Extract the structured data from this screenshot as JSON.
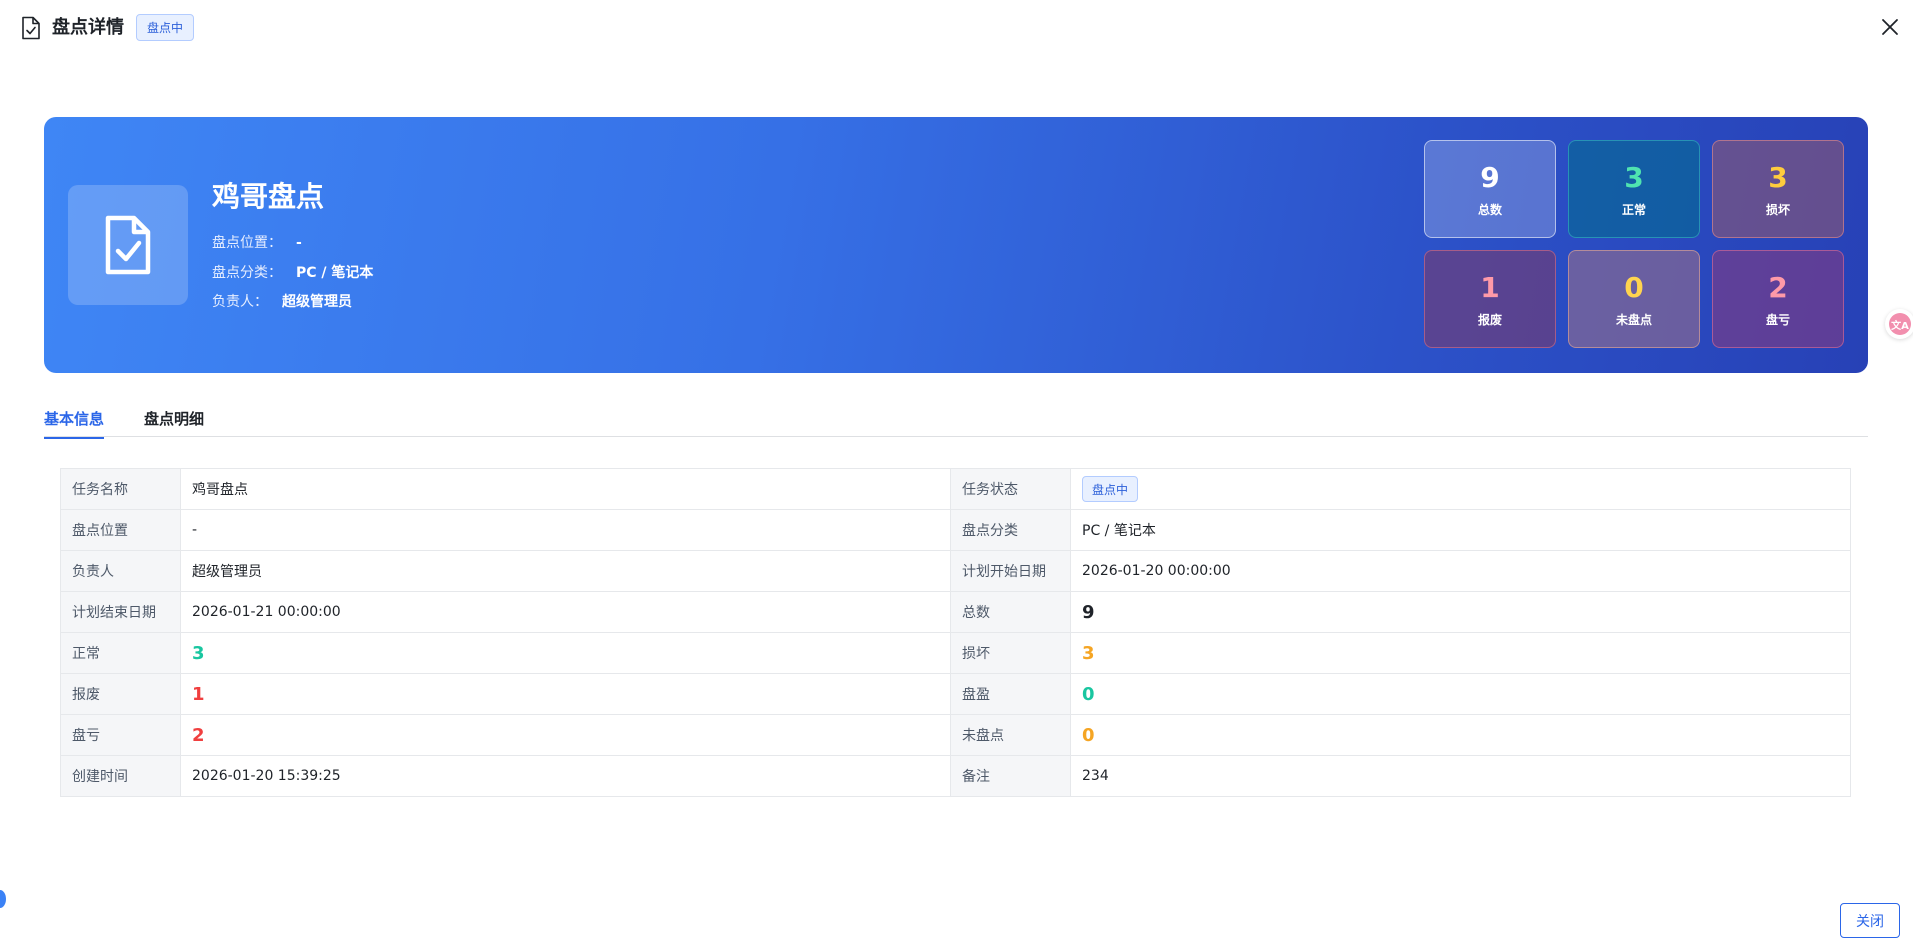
{
  "header": {
    "title": "盘点详情",
    "status_tag": "盘点中",
    "icon": "document-check-icon",
    "close_icon": "close-icon"
  },
  "banner": {
    "icon": "document-check-icon",
    "name": "鸡哥盘点",
    "meta": [
      {
        "label": "盘点位置：",
        "value": "-"
      },
      {
        "label": "盘点分类：",
        "value": "PC / 笔记本"
      },
      {
        "label": "负责人：",
        "value": "超级管理员"
      }
    ],
    "stats": [
      {
        "value": "9",
        "label": "总数"
      },
      {
        "value": "3",
        "label": "正常"
      },
      {
        "value": "3",
        "label": "损坏"
      },
      {
        "value": "1",
        "label": "报废"
      },
      {
        "value": "0",
        "label": "未盘点"
      },
      {
        "value": "2",
        "label": "盘亏"
      }
    ]
  },
  "tabs": [
    {
      "label": "基本信息",
      "active": true
    },
    {
      "label": "盘点明细",
      "active": false
    }
  ],
  "info": {
    "rows": [
      {
        "k1": "任务名称",
        "v1": "鸡哥盘点",
        "k2": "任务状态",
        "v2": "盘点中"
      },
      {
        "k1": "盘点位置",
        "v1": "-",
        "k2": "盘点分类",
        "v2": "PC / 笔记本"
      },
      {
        "k1": "负责人",
        "v1": "超级管理员",
        "k2": "计划开始日期",
        "v2": "2026-01-20 00:00:00"
      },
      {
        "k1": "计划结束日期",
        "v1": "2026-01-21 00:00:00",
        "k2": "总数",
        "v2": "9"
      },
      {
        "k1": "正常",
        "v1": "3",
        "k2": "损坏",
        "v2": "3"
      },
      {
        "k1": "报废",
        "v1": "1",
        "k2": "盘盈",
        "v2": "0"
      },
      {
        "k1": "盘亏",
        "v1": "2",
        "k2": "未盘点",
        "v2": "0"
      },
      {
        "k1": "创建时间",
        "v1": "2026-01-20 15:39:25",
        "k2": "备注",
        "v2": "234"
      }
    ]
  },
  "footer": {
    "close_label": "关闭"
  },
  "translate_fab": {
    "icon": "translate-icon",
    "text": "文A"
  },
  "colors": {
    "primary": "#2b66e8",
    "normal": "#19c6a0",
    "broken": "#f5a524",
    "scrap": "#f03f3f"
  }
}
